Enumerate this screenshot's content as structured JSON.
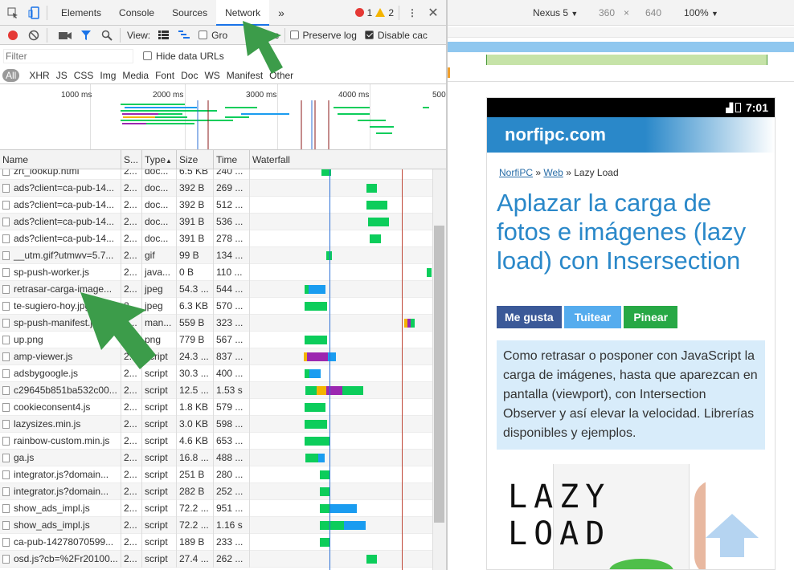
{
  "devtools": {
    "tabs": [
      "Elements",
      "Console",
      "Sources",
      "Network"
    ],
    "more_tabs": "»",
    "error_count": "1",
    "warning_count": "2",
    "view_label": "View:",
    "group_by_frame": "Group by frame",
    "group_partial": "Gro",
    "frame_partial": "rame",
    "preserve_log": "Preserve log",
    "disable_cache": "Disable cac",
    "filter_placeholder": "Filter",
    "hide_data_urls": "Hide data URLs",
    "type_filters": [
      "All",
      "XHR",
      "JS",
      "CSS",
      "Img",
      "Media",
      "Font",
      "Doc",
      "WS",
      "Manifest",
      "Other"
    ],
    "overview_ticks": [
      "1000 ms",
      "2000 ms",
      "3000 ms",
      "4000 ms",
      "500"
    ],
    "columns": [
      "Name",
      "S...",
      "Type",
      "Size",
      "Time",
      "Waterfall"
    ],
    "rows": [
      {
        "name": "zrt_lookup.html",
        "status": "2...",
        "type": "doc...",
        "size": "6.5 KB",
        "time": "240 ..."
      },
      {
        "name": "ads?client=ca-pub-14...",
        "status": "2...",
        "type": "doc...",
        "size": "392 B",
        "time": "269 ..."
      },
      {
        "name": "ads?client=ca-pub-14...",
        "status": "2...",
        "type": "doc...",
        "size": "392 B",
        "time": "512 ..."
      },
      {
        "name": "ads?client=ca-pub-14...",
        "status": "2...",
        "type": "doc...",
        "size": "391 B",
        "time": "536 ..."
      },
      {
        "name": "ads?client=ca-pub-14...",
        "status": "2...",
        "type": "doc...",
        "size": "391 B",
        "time": "278 ..."
      },
      {
        "name": "__utm.gif?utmwv=5.7...",
        "status": "2...",
        "type": "gif",
        "size": "99 B",
        "time": "134 ..."
      },
      {
        "name": "sp-push-worker.js",
        "status": "2...",
        "type": "java...",
        "size": "0 B",
        "time": "110 ..."
      },
      {
        "name": "retrasar-carga-image...",
        "status": "2...",
        "type": "jpeg",
        "size": "54.3 ...",
        "time": "544 ..."
      },
      {
        "name": "te-sugiero-hoy.jpg",
        "status": "2...",
        "type": "jpeg",
        "size": "6.3 KB",
        "time": "570 ..."
      },
      {
        "name": "sp-push-manifest.json",
        "status": "2...",
        "type": "man...",
        "size": "559 B",
        "time": "323 ..."
      },
      {
        "name": "up.png",
        "status": "2...",
        "type": "png",
        "size": "779 B",
        "time": "567 ..."
      },
      {
        "name": "amp-viewer.js",
        "status": "2...",
        "type": "script",
        "size": "24.3 ...",
        "time": "837 ..."
      },
      {
        "name": "adsbygoogle.js",
        "status": "2...",
        "type": "script",
        "size": "30.3 ...",
        "time": "400 ..."
      },
      {
        "name": "c29645b851ba532c00...",
        "status": "2...",
        "type": "script",
        "size": "12.5 ...",
        "time": "1.53 s"
      },
      {
        "name": "cookieconsent4.js",
        "status": "2...",
        "type": "script",
        "size": "1.8 KB",
        "time": "579 ..."
      },
      {
        "name": "lazysizes.min.js",
        "status": "2...",
        "type": "script",
        "size": "3.0 KB",
        "time": "598 ..."
      },
      {
        "name": "rainbow-custom.min.js",
        "status": "2...",
        "type": "script",
        "size": "4.6 KB",
        "time": "653 ..."
      },
      {
        "name": "ga.js",
        "status": "2...",
        "type": "script",
        "size": "16.8 ...",
        "time": "488 ..."
      },
      {
        "name": "integrator.js?domain...",
        "status": "2...",
        "type": "script",
        "size": "251 B",
        "time": "280 ..."
      },
      {
        "name": "integrator.js?domain...",
        "status": "2...",
        "type": "script",
        "size": "282 B",
        "time": "252 ..."
      },
      {
        "name": "show_ads_impl.js",
        "status": "2...",
        "type": "script",
        "size": "72.2 ...",
        "time": "951 ..."
      },
      {
        "name": "show_ads_impl.js",
        "status": "2...",
        "type": "script",
        "size": "72.2 ...",
        "time": "1.16 s"
      },
      {
        "name": "ca-pub-14278070599...",
        "status": "2...",
        "type": "script",
        "size": "189 B",
        "time": "233 ..."
      },
      {
        "name": "osd.js?cb=%2Fr20100...",
        "status": "2...",
        "type": "script",
        "size": "27.4 ...",
        "time": "262 ..."
      }
    ]
  },
  "device": {
    "name": "Nexus 5",
    "width": "360",
    "times": "×",
    "height": "640",
    "zoom": "100%",
    "clock": "7:01"
  },
  "site": {
    "brand": "norfipc.com",
    "breadcrumb_home": "NorfiPC",
    "breadcrumb_sep1": "»",
    "breadcrumb_web": "Web",
    "breadcrumb_sep2": "»",
    "breadcrumb_current": "Lazy Load",
    "title": "Aplazar la carga de fotos e imágenes (lazy load) con Insersection",
    "like": "Me gusta",
    "tweet": "Tuitear",
    "pin": "Pinear",
    "summary": "Como retrasar o posponer con JavaScript la carga de imágenes, hasta que aparezcan en pantalla (viewport), con Intersection Observer y así elevar la velocidad. Librerías disponibles y ejemplos.",
    "image_text_line1": "LAZY",
    "image_text_line2": "LOAD"
  },
  "colors": {
    "accent": "#1a73e8",
    "green": "#0ccd5b",
    "blue": "#1a9cf0",
    "site_blue": "#2a88c9",
    "fb": "#3b5998",
    "tw": "#55acee",
    "pin": "#27a845"
  }
}
